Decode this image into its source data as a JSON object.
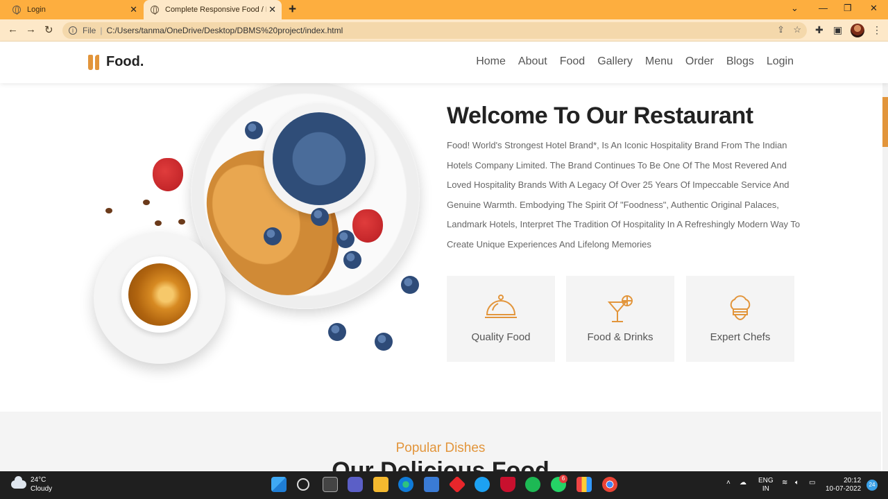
{
  "browser": {
    "tabs": [
      {
        "title": "Login"
      },
      {
        "title": "Complete Responsive Food / Res"
      }
    ],
    "address": {
      "scheme_label": "File",
      "url": "C:/Users/tanma/OneDrive/Desktop/DBMS%20project/index.html"
    }
  },
  "site": {
    "logo_text": "Food.",
    "nav": [
      "Home",
      "About",
      "Food",
      "Gallery",
      "Menu",
      "Order",
      "Blogs",
      "Login"
    ],
    "about": {
      "title": "Welcome To Our Restaurant",
      "text": "Food! World's Strongest Hotel Brand*, Is An Iconic Hospitality Brand From The Indian Hotels Company Limited. The Brand Continues To Be One Of The Most Revered And Loved Hospitality Brands With A Legacy Of Over 25 Years Of Impeccable Service And Genuine Warmth. Embodying The Spirit Of \"Foodness\", Authentic Original Palaces, Landmark Hotels, Interpret The Tradition Of Hospitality In A Refreshingly Modern Way To Create Unique Experiences And Lifelong Memories"
    },
    "features": [
      {
        "label": "Quality Food",
        "icon": "cloche-icon"
      },
      {
        "label": "Food & Drinks",
        "icon": "cocktail-icon"
      },
      {
        "label": "Expert Chefs",
        "icon": "chef-hat-icon"
      }
    ],
    "popular": {
      "subtitle": "Popular Dishes",
      "title": "Our Delicious Food"
    },
    "accent_color": "#e2953b"
  },
  "taskbar": {
    "weather_temp": "24°C",
    "weather_desc": "Cloudy",
    "lang_top": "ENG",
    "lang_bottom": "IN",
    "time": "20:12",
    "date": "10-07-2022",
    "notification_count": "24",
    "whatsapp_badge": "6"
  }
}
